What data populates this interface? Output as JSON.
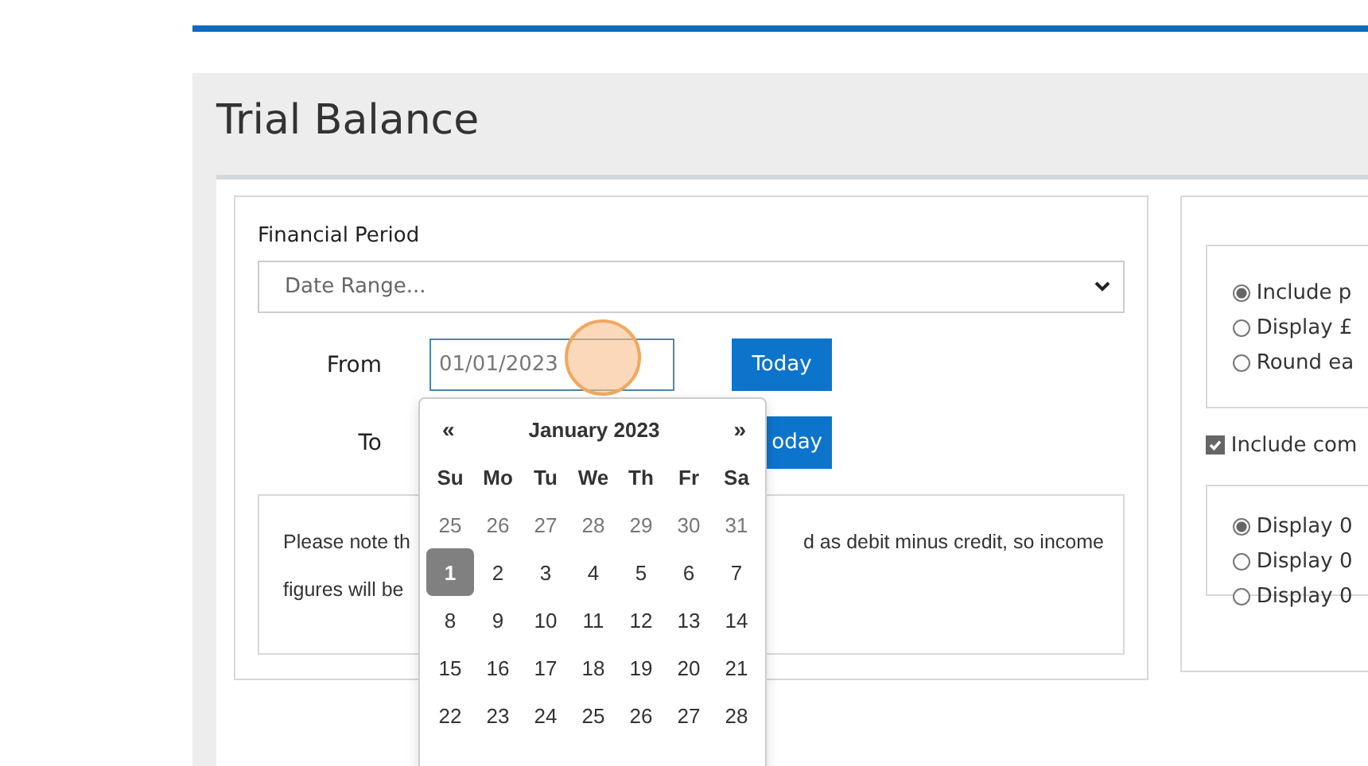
{
  "header": {
    "title": "Trial Balance"
  },
  "period": {
    "label": "Financial Period",
    "select_value": "Date Range..."
  },
  "date_rows": [
    {
      "label": "From",
      "value": "01/01/2023",
      "button": "Today"
    },
    {
      "label": "To",
      "button": "oday"
    }
  ],
  "note": {
    "lines": [
      [
        "Please note th",
        "d as debit minus credit, so income"
      ],
      [
        "figures will be"
      ]
    ]
  },
  "calendar": {
    "prev": "«",
    "title": "January 2023",
    "next": "»",
    "weekdays": [
      "Su",
      "Mo",
      "Tu",
      "We",
      "Th",
      "Fr",
      "Sa"
    ],
    "weeks": [
      [
        {
          "day": "25",
          "muted": true,
          "selected": false
        },
        {
          "day": "26",
          "muted": true,
          "selected": false
        },
        {
          "day": "27",
          "muted": true,
          "selected": false
        },
        {
          "day": "28",
          "muted": true,
          "selected": false
        },
        {
          "day": "29",
          "muted": true,
          "selected": false
        },
        {
          "day": "30",
          "muted": true,
          "selected": false
        },
        {
          "day": "31",
          "muted": true,
          "selected": false
        }
      ],
      [
        {
          "day": "1",
          "muted": false,
          "selected": true
        },
        {
          "day": "2",
          "muted": false,
          "selected": false
        },
        {
          "day": "3",
          "muted": false,
          "selected": false
        },
        {
          "day": "4",
          "muted": false,
          "selected": false
        },
        {
          "day": "5",
          "muted": false,
          "selected": false
        },
        {
          "day": "6",
          "muted": false,
          "selected": false
        },
        {
          "day": "7",
          "muted": false,
          "selected": false
        }
      ],
      [
        {
          "day": "8",
          "muted": false,
          "selected": false
        },
        {
          "day": "9",
          "muted": false,
          "selected": false
        },
        {
          "day": "10",
          "muted": false,
          "selected": false
        },
        {
          "day": "11",
          "muted": false,
          "selected": false
        },
        {
          "day": "12",
          "muted": false,
          "selected": false
        },
        {
          "day": "13",
          "muted": false,
          "selected": false
        },
        {
          "day": "14",
          "muted": false,
          "selected": false
        }
      ],
      [
        {
          "day": "15",
          "muted": false,
          "selected": false
        },
        {
          "day": "16",
          "muted": false,
          "selected": false
        },
        {
          "day": "17",
          "muted": false,
          "selected": false
        },
        {
          "day": "18",
          "muted": false,
          "selected": false
        },
        {
          "day": "19",
          "muted": false,
          "selected": false
        },
        {
          "day": "20",
          "muted": false,
          "selected": false
        },
        {
          "day": "21",
          "muted": false,
          "selected": false
        }
      ],
      [
        {
          "day": "22",
          "muted": false,
          "selected": false
        },
        {
          "day": "23",
          "muted": false,
          "selected": false
        },
        {
          "day": "24",
          "muted": false,
          "selected": false
        },
        {
          "day": "25",
          "muted": false,
          "selected": false
        },
        {
          "day": "26",
          "muted": false,
          "selected": false
        },
        {
          "day": "27",
          "muted": false,
          "selected": false
        },
        {
          "day": "28",
          "muted": false,
          "selected": false
        }
      ]
    ]
  },
  "options": {
    "group_1": [
      {
        "label": "Include p",
        "selected": true
      },
      {
        "label": "Display £",
        "selected": false
      },
      {
        "label": "Round ea",
        "selected": false
      }
    ],
    "checkbox": {
      "label": "Include com",
      "checked": true
    },
    "group_2": [
      {
        "label": "Display 0",
        "selected": true
      },
      {
        "label": "Display 0",
        "selected": false
      },
      {
        "label": "Display 0",
        "selected": false
      }
    ]
  }
}
